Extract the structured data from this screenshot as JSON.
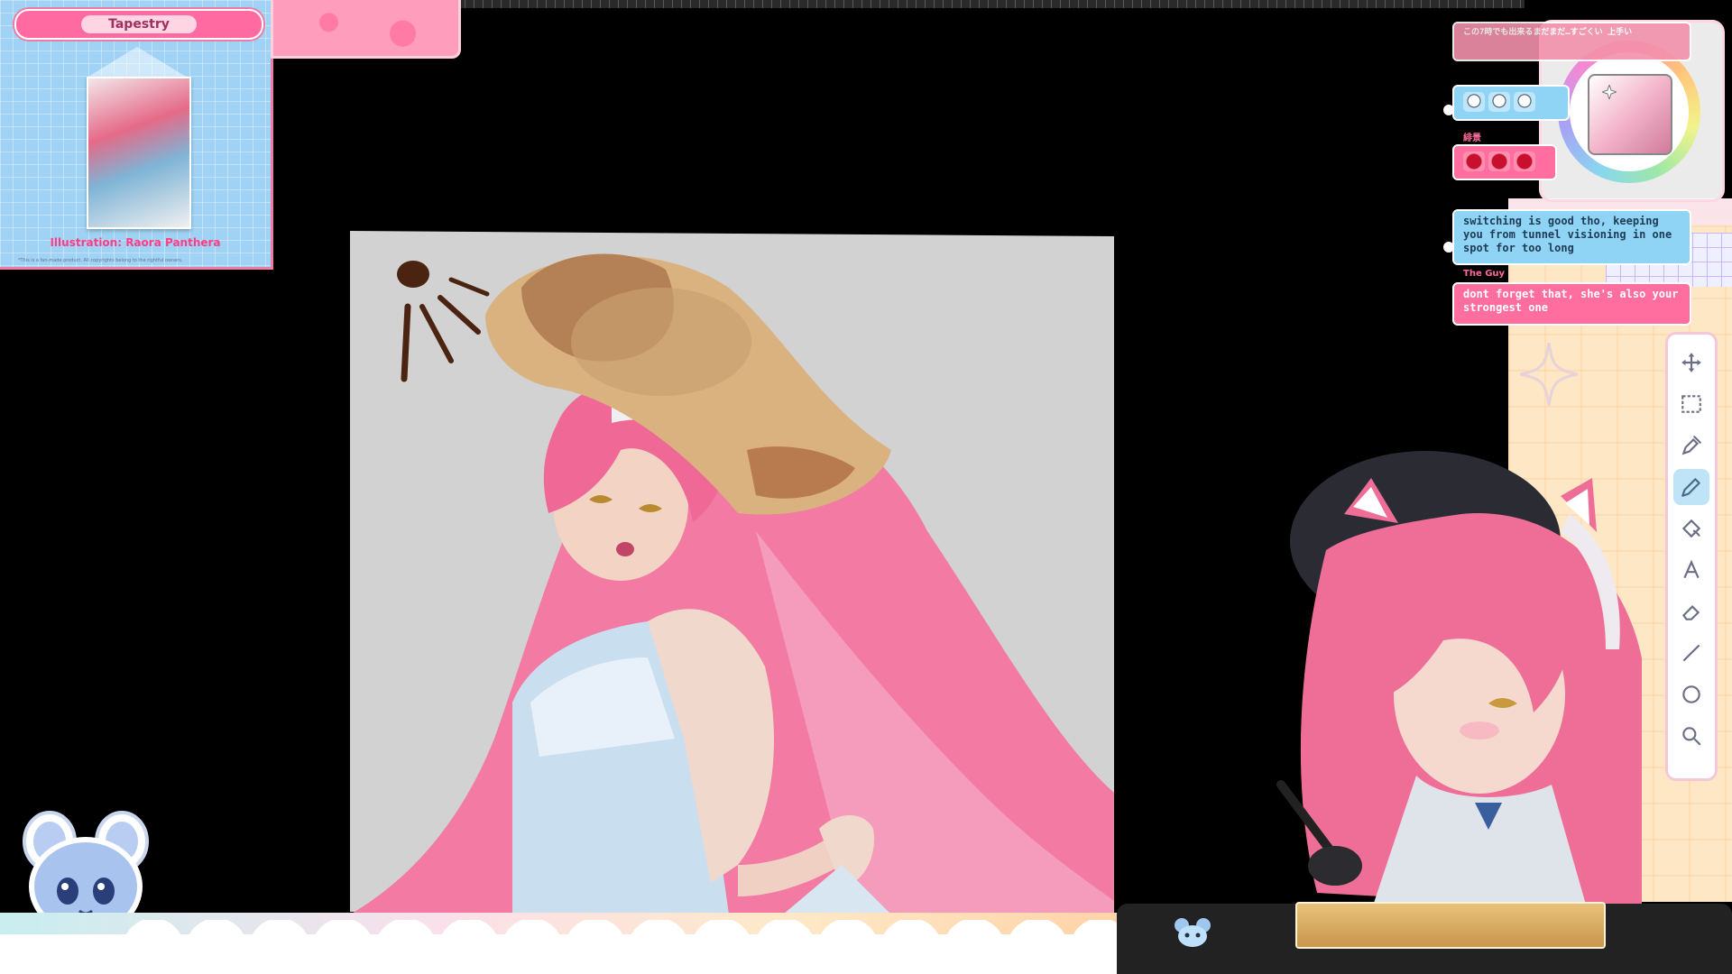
{
  "tapestry": {
    "title": "Tapestry",
    "credit": "Illustration: Raora Panthera",
    "fineprint": "*This is a fan-made product. All copyrights belong to the rightful owners."
  },
  "chat": {
    "messages": [
      {
        "author": "",
        "text": "この7時でも出来るまだまだ…すごくい 上手い",
        "style": "pink"
      },
      {
        "author": "",
        "text": "",
        "emotes": [
          "blue",
          "blue",
          "blue"
        ],
        "style": "blue"
      },
      {
        "author": "緋景",
        "text": "",
        "emotes": [
          "heart",
          "heart",
          "heart"
        ],
        "style": "pink"
      },
      {
        "author": "",
        "text": "switching is good tho, keeping you from tunnel visioning in one spot for too long",
        "style": "blue"
      },
      {
        "author": "The Guy",
        "text": "dont forget that, she's also your strongest one",
        "style": "pink"
      }
    ]
  },
  "colors": {
    "accent_pink": "#ff6e9e",
    "accent_blue": "#8fd3f5",
    "canvas_bg": "#d2d2d3",
    "current_color": "#f3b5cb"
  },
  "toolbar": {
    "tools": [
      {
        "name": "move-icon",
        "active": false
      },
      {
        "name": "select-icon",
        "active": false
      },
      {
        "name": "eyedropper-icon",
        "active": false
      },
      {
        "name": "pencil-icon",
        "active": true
      },
      {
        "name": "fill-icon",
        "active": false
      },
      {
        "name": "text-icon",
        "active": false
      },
      {
        "name": "eraser-icon",
        "active": false
      },
      {
        "name": "line-icon",
        "active": false
      },
      {
        "name": "circle-icon",
        "active": false
      },
      {
        "name": "zoom-icon",
        "active": false
      }
    ]
  }
}
